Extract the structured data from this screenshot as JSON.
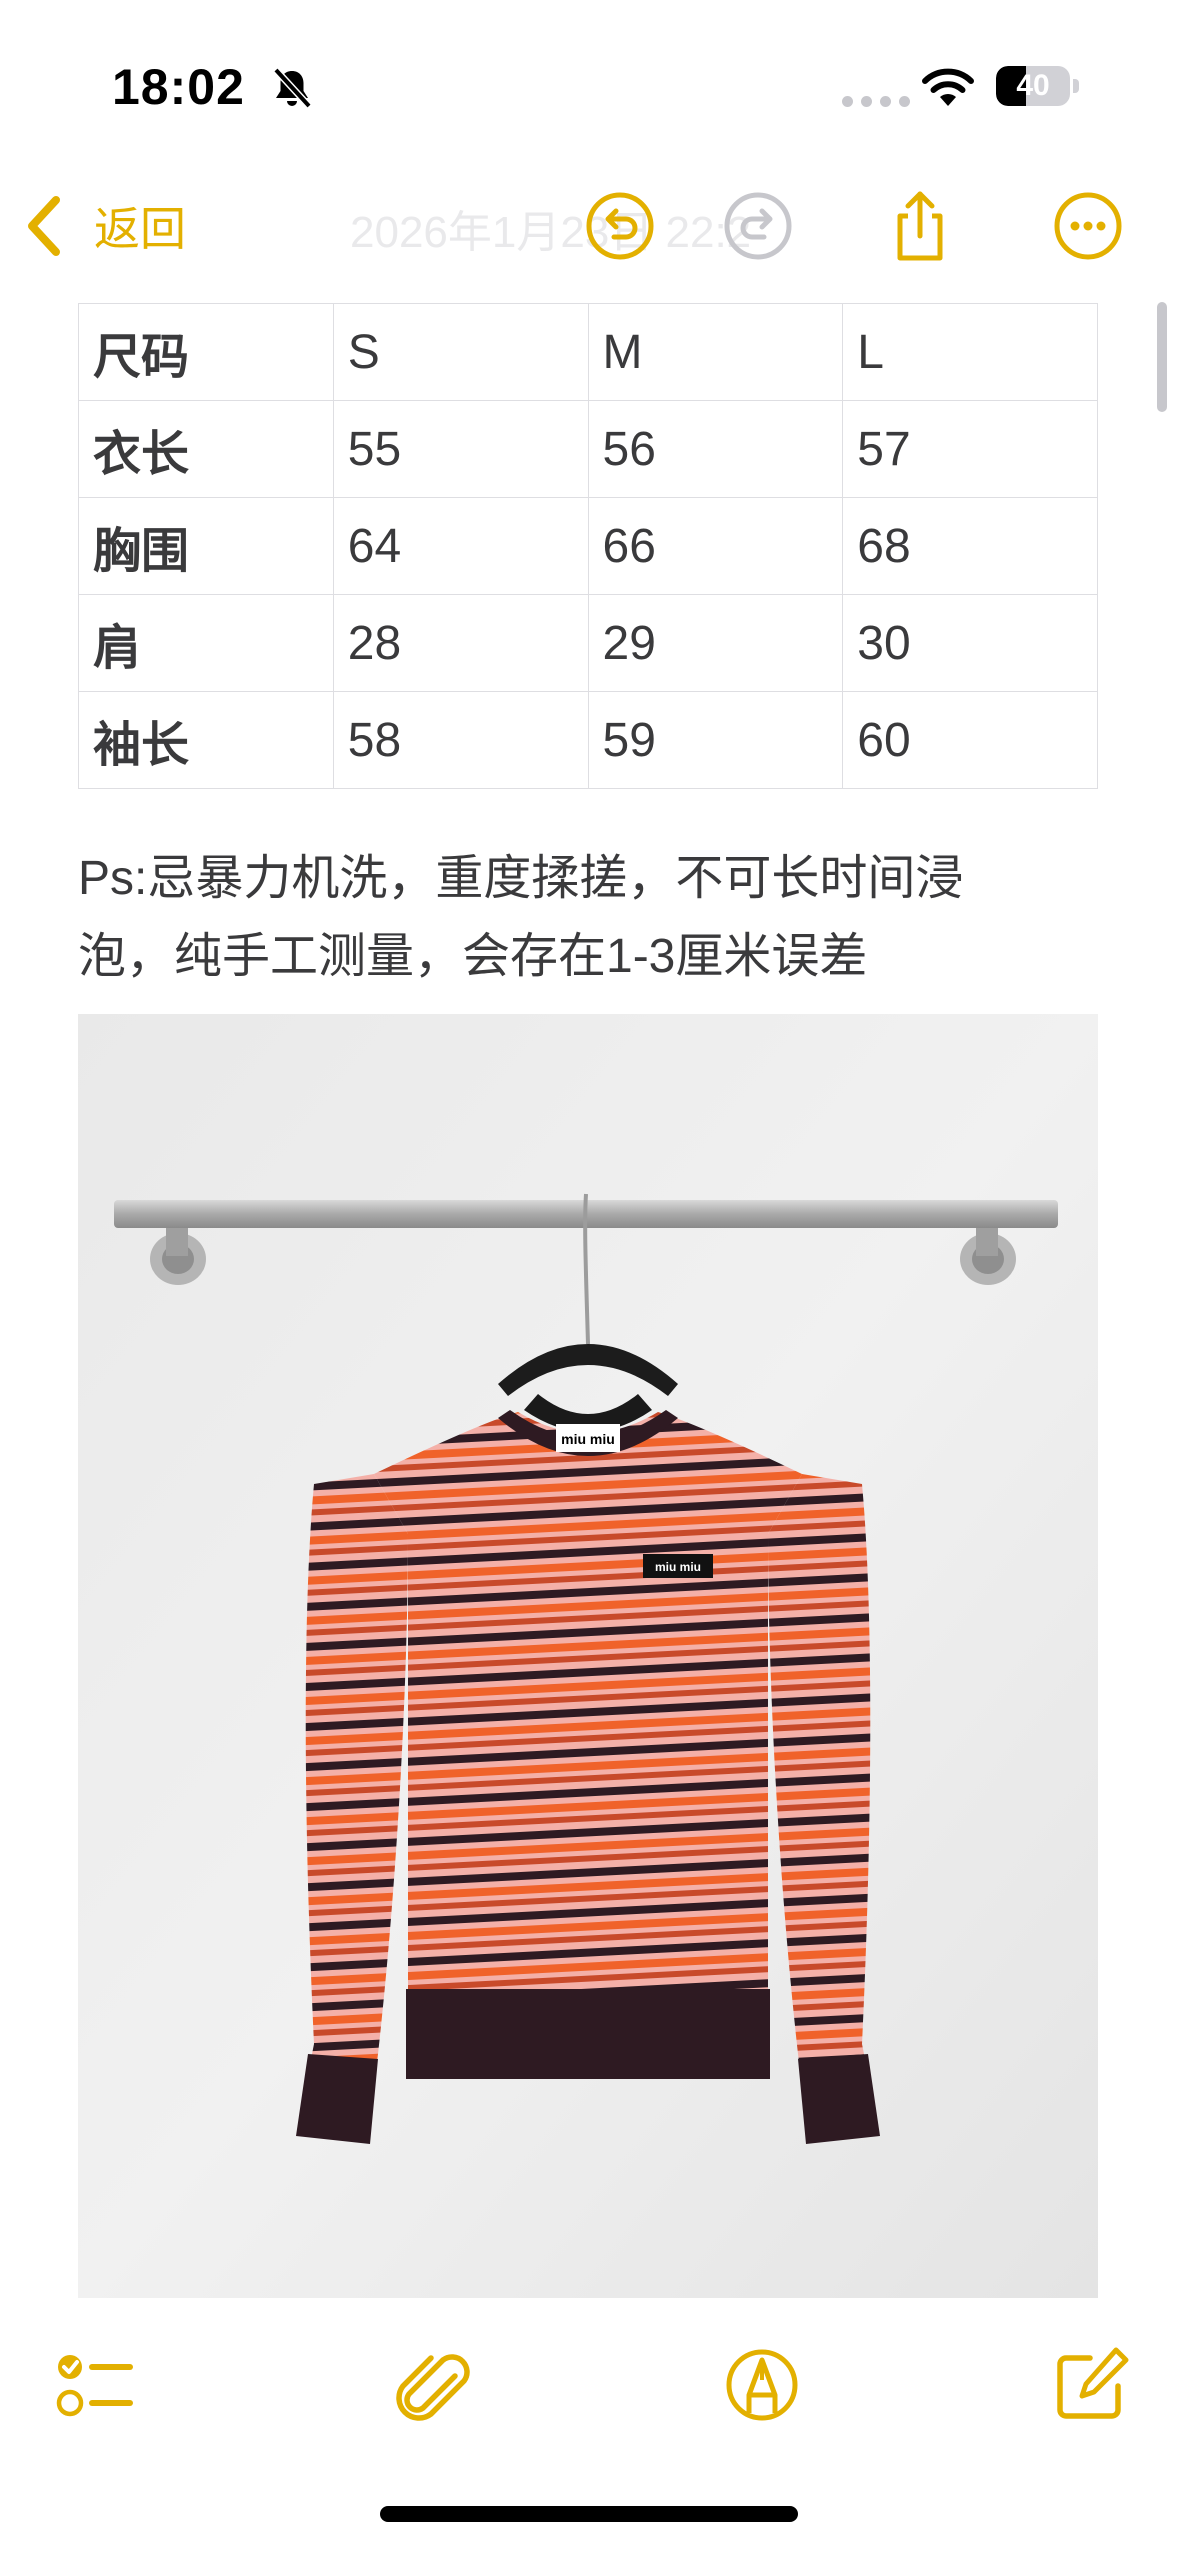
{
  "status_bar": {
    "time": "18:02",
    "battery_label": "40",
    "battery_level_percent": 40,
    "icons": {
      "silent": "bell-slash-icon",
      "cellular": "signal-dots-icon",
      "wifi": "wifi-icon",
      "battery": "battery-icon"
    }
  },
  "nav": {
    "back_label": "返回",
    "title": "2026年1月23日 22:2",
    "icons": {
      "back": "chevron-left-icon",
      "undo": "undo-icon",
      "redo": "redo-icon",
      "share": "share-icon",
      "more": "more-icon"
    }
  },
  "size_table": {
    "header": [
      "尺码",
      "S",
      "M",
      "L"
    ],
    "rows": [
      [
        "衣长",
        "55",
        "56",
        "57"
      ],
      [
        "胸围",
        "64",
        "66",
        "68"
      ],
      [
        "肩",
        "28",
        "29",
        "30"
      ],
      [
        "袖长",
        "58",
        "59",
        "60"
      ]
    ]
  },
  "note": {
    "line1": "Ps:忌暴力机洗，重度揉搓，不可长时间浸",
    "line2": "泡，纯手工测量，会存在1-3厘米误差"
  },
  "photo": {
    "subject": "sweater-photo",
    "neck_label_text": "miu miu",
    "chest_patch_text": "miu miu"
  },
  "toolbar": {
    "icons": {
      "checklist": "checklist-icon",
      "attachment": "paperclip-icon",
      "markup": "pen-tip-icon",
      "compose": "compose-icon"
    }
  },
  "colors": {
    "accent": "#e3b000",
    "text": "#3a3a3c",
    "table_border": "#dedee2",
    "stripe_orange": "#f0622a",
    "stripe_pink": "#f4b0a8",
    "stripe_dark": "#2e1a22"
  }
}
